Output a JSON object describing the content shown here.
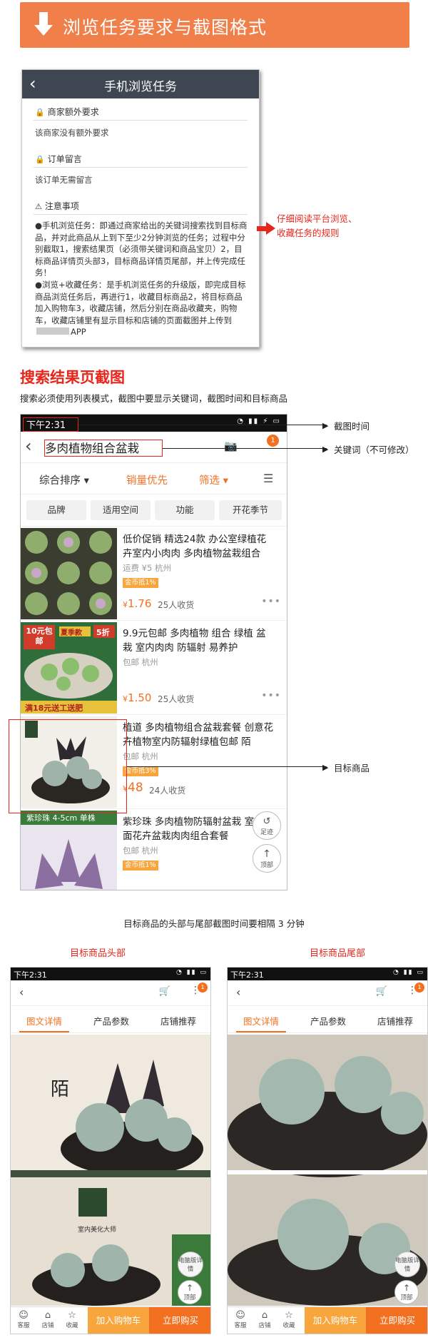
{
  "banner": {
    "title": "浏览任务要求与截图格式"
  },
  "task_phone": {
    "title": "手机浏览任务",
    "sec1_title": "商家额外要求",
    "sec1_body": "该商家没有额外要求",
    "sec2_title": "订单留言",
    "sec2_body": "该订单无需留言",
    "sec3_title": "注意事项",
    "note": "●手机浏览任务：即通过商家给出的关键词搜索找到目标商品，并对此商品从上到下至少2分钟浏览的任务；过程中分别截取1，搜索结果页（必须带关键词和商品宝贝）2，目标商品详情页头部3，目标商品详情页尾部，并上传完成任务！\n●浏览+收藏任务：是手机浏览任务的升级版，即完成目标商品浏览任务后，再进行1，收藏目标商品2，将目标商品加入购物车3，收藏店铺，然后分别在商品收藏夹，购物车，收藏店铺里有显示目标和店铺的页面截图并上传到",
    "note_tail": "APP"
  },
  "tip": {
    "line1": "仔细阅读平台浏览、",
    "line2": "收藏任务的规则"
  },
  "section": {
    "heading": "搜索结果页截图",
    "desc": "搜索必须使用列表模式，截图中要显示关键词，截图时间和目标商品"
  },
  "search_phone": {
    "time": "下午2:31",
    "keyword": "多肉植物组合盆栽",
    "badge": "1",
    "sort": [
      "综合排序 ▾",
      "销量优先",
      "筛选 ▾"
    ],
    "filters": [
      "品牌",
      "适用空间",
      "功能",
      "开花季节"
    ],
    "items": [
      {
        "title": "低价促销 精选24款 办公室绿植花卉室内小肉肉 多肉植物盆栽组合",
        "meta": "运费 ¥5  杭州",
        "coin": "金币抵1%",
        "price": "1.76",
        "sold": "25人收货"
      },
      {
        "title": "9.9元包邮 多肉植物 组合 绿植 盆栽 室内肉肉 防辐射 易养护",
        "meta": "包邮  杭州",
        "coin": "",
        "price": "1.50",
        "sold": "25人收货",
        "img_top": "10元包邮",
        "img_tag": "夏季款",
        "img_sale": "5折",
        "img_bottom": "满18元送工送肥"
      },
      {
        "title": "植道 多肉植物组合盆栽套餐 创意花卉植物室内防辐射绿植包邮 陌",
        "meta": "包邮  杭州",
        "coin": "金币抵3%",
        "price": "48",
        "sold": "24人收货"
      },
      {
        "title": "紫珍珠 多肉植物防辐射盆栽 室内桌面花卉盆栽肉肉组合套餐",
        "meta": "包邮  杭州",
        "coin": "金币抵1%",
        "img_top": "紫珍珠 4-5cm 单株"
      }
    ],
    "fab1": "足迹",
    "fab2": "顶部"
  },
  "labels": {
    "time": "截图时间",
    "keyword": "关键词（不可修改）",
    "target": "目标商品"
  },
  "mid_text": "目标商品的头部与尾部截图时间要相隔 3 分钟",
  "head_title": "目标商品头部",
  "tail_title": "目标商品尾部",
  "detail_phone": {
    "time": "下午2:31",
    "badge": "1",
    "tabs": [
      "图文详情",
      "产品参数",
      "店铺推荐"
    ],
    "foot": [
      "客服",
      "店铺",
      "收藏"
    ],
    "add_cart": "加入购物车",
    "buy_now": "立即购买",
    "pc_btn": "电脑版详情",
    "top_btn": "顶部",
    "poster_char": "陌",
    "brand": "室内美化大师"
  }
}
